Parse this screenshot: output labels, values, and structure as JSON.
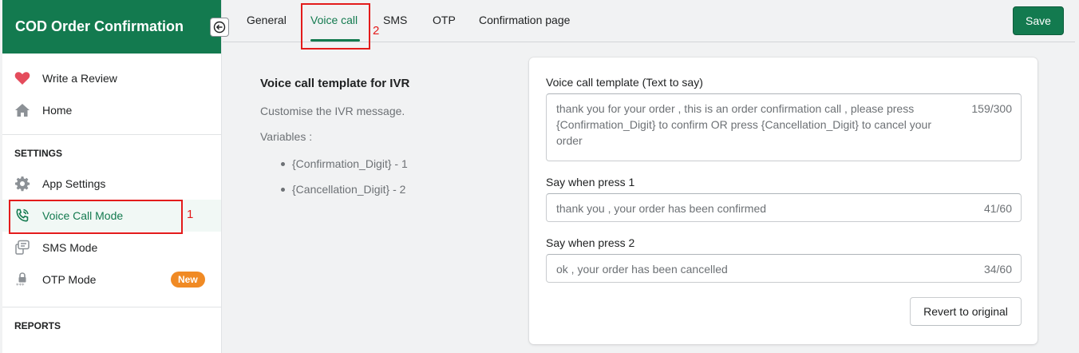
{
  "app": {
    "title": "COD Order Confirmation"
  },
  "sidebar": {
    "items": [
      {
        "label": "Write a Review",
        "icon": "heart-icon"
      },
      {
        "label": "Home",
        "icon": "home-icon"
      }
    ],
    "settings_label": "SETTINGS",
    "settings_items": [
      {
        "label": "App Settings",
        "icon": "gear-icon"
      },
      {
        "label": "Voice Call Mode",
        "icon": "phone-call-icon",
        "active": true
      },
      {
        "label": "SMS Mode",
        "icon": "sms-icon"
      },
      {
        "label": "OTP Mode",
        "icon": "otp-lock-icon",
        "badge": "New"
      }
    ],
    "reports_label": "REPORTS"
  },
  "tabs": [
    {
      "label": "General"
    },
    {
      "label": "Voice call",
      "active": true
    },
    {
      "label": "SMS"
    },
    {
      "label": "OTP"
    },
    {
      "label": "Confirmation page"
    }
  ],
  "toolbar": {
    "save_label": "Save"
  },
  "description": {
    "title": "Voice call template for IVR",
    "text": "Customise the IVR message.",
    "variables_label": "Variables :",
    "variables": [
      "{Confirmation_Digit} - 1",
      "{Cancellation_Digit} - 2"
    ]
  },
  "form": {
    "template": {
      "label": "Voice call template (Text to say)",
      "value": "thank you for your order , this is an order confirmation call , please press {Confirmation_Digit} to confirm OR press {Cancellation_Digit} to cancel your order",
      "count": "159/300"
    },
    "press1": {
      "label": "Say when press 1",
      "value": "thank you , your order has been confirmed",
      "count": "41/60"
    },
    "press2": {
      "label": "Say when press 2",
      "value": "ok , your order has been cancelled",
      "count": "34/60"
    },
    "revert_label": "Revert to original"
  },
  "annotations": {
    "one": "1",
    "two": "2"
  },
  "colors": {
    "brand": "#137a4f",
    "badge": "#f08a24",
    "annotation": "#e31b1b"
  }
}
